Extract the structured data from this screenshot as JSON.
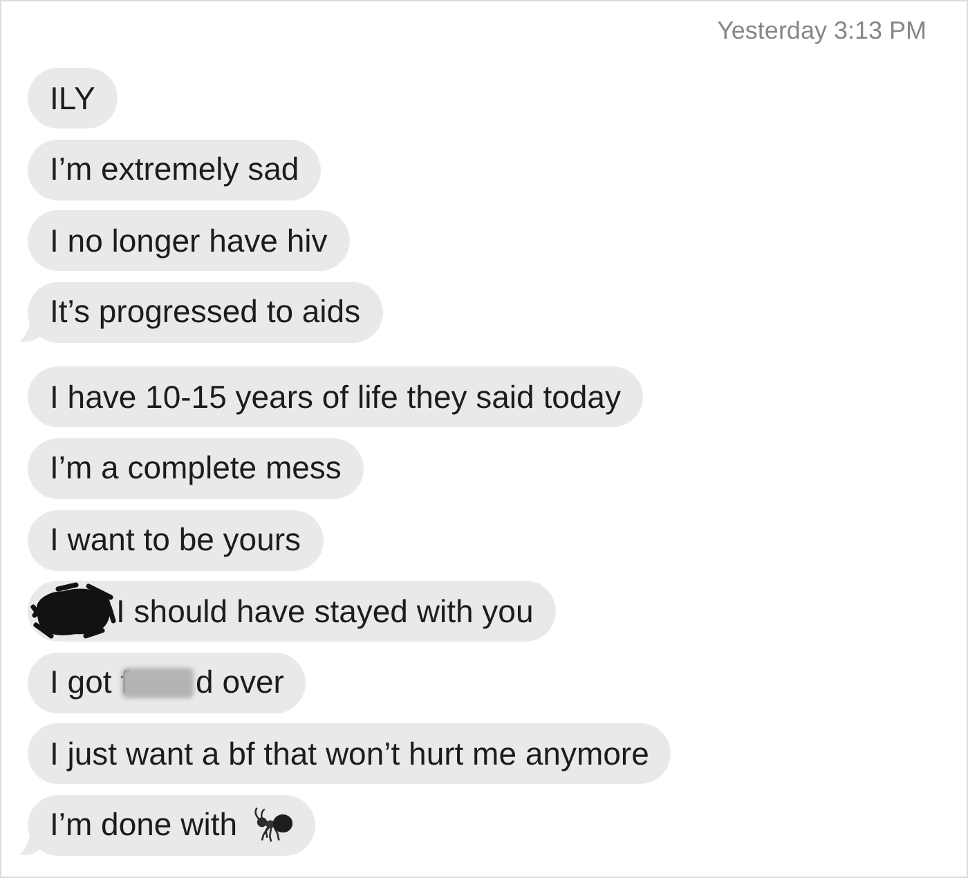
{
  "timestamp": "Yesterday 3:13 PM",
  "messages": [
    {
      "tail": false,
      "parts": [
        {
          "kind": "text",
          "text": "ILY"
        }
      ]
    },
    {
      "tail": false,
      "parts": [
        {
          "kind": "text",
          "text": "I’m extremely sad"
        }
      ]
    },
    {
      "tail": false,
      "parts": [
        {
          "kind": "text",
          "text": "I no longer have hiv"
        }
      ]
    },
    {
      "tail": true,
      "parts": [
        {
          "kind": "text",
          "text": "It’s progressed to aids"
        }
      ]
    },
    {
      "tail": false,
      "parts": [
        {
          "kind": "text",
          "text": "I have 10-15 years of life they said today"
        }
      ]
    },
    {
      "tail": false,
      "parts": [
        {
          "kind": "text",
          "text": "I’m a complete mess"
        }
      ]
    },
    {
      "tail": false,
      "parts": [
        {
          "kind": "text",
          "text": "I want to be yours"
        }
      ]
    },
    {
      "tail": false,
      "parts": [
        {
          "kind": "scribble"
        },
        {
          "kind": "text",
          "text": "I should have stayed with you"
        }
      ]
    },
    {
      "tail": false,
      "parts": [
        {
          "kind": "text",
          "text": "I got f"
        },
        {
          "kind": "blur"
        },
        {
          "kind": "text",
          "text": "d over"
        }
      ]
    },
    {
      "tail": false,
      "parts": [
        {
          "kind": "text",
          "text": "I just want a bf that won’t hurt me anymore"
        }
      ]
    },
    {
      "tail": true,
      "parts": [
        {
          "kind": "text",
          "text": "I’m done with"
        },
        {
          "kind": "emoji"
        }
      ]
    }
  ]
}
